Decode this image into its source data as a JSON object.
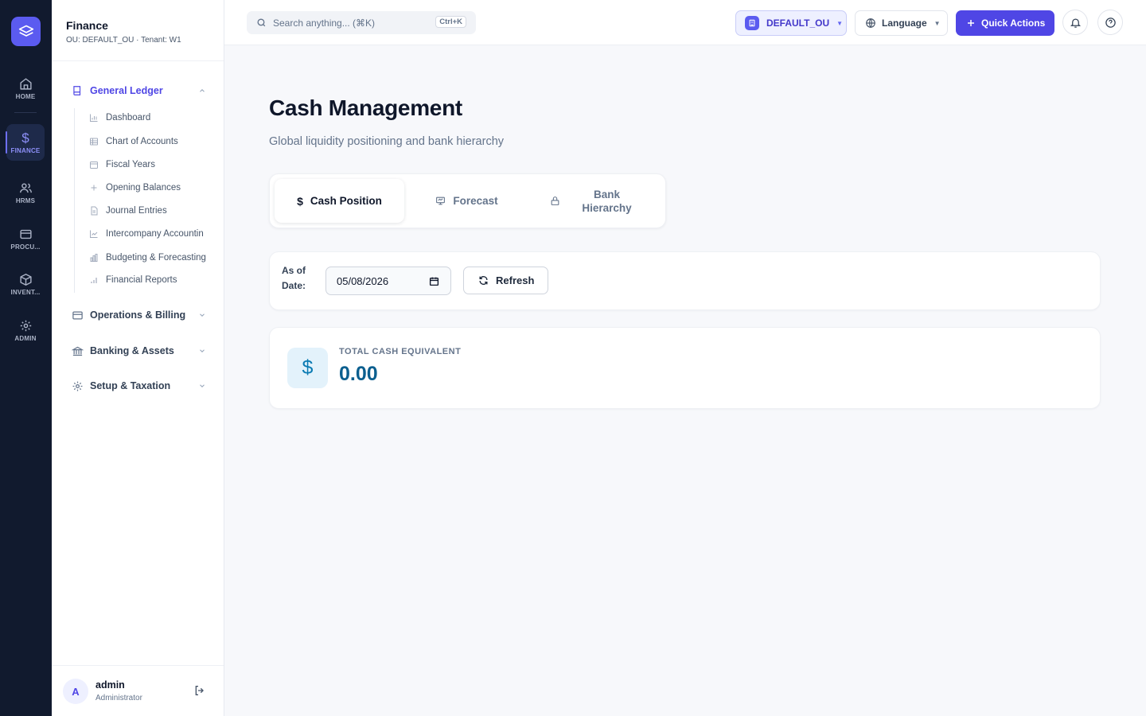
{
  "rail": {
    "items": [
      {
        "label": "HOME",
        "icon": "home-icon"
      },
      {
        "label": "FINANCE",
        "icon": "dollar-icon"
      },
      {
        "label": "HRMS",
        "icon": "users-icon"
      },
      {
        "label": "PROCU...",
        "icon": "card-icon"
      },
      {
        "label": "INVENT...",
        "icon": "box-icon"
      },
      {
        "label": "ADMIN",
        "icon": "gear-icon"
      }
    ]
  },
  "sidebar": {
    "title": "Finance",
    "subtitle": "OU: DEFAULT_OU · Tenant: W1",
    "groups": [
      {
        "label": "General Ledger",
        "icon": "book-icon"
      },
      {
        "label": "Operations & Billing",
        "icon": "card-icon"
      },
      {
        "label": "Banking & Assets",
        "icon": "bank-icon"
      },
      {
        "label": "Setup & Taxation",
        "icon": "gear-icon"
      }
    ],
    "sub_items": [
      {
        "label": "Dashboard",
        "icon": "bar-chart-icon"
      },
      {
        "label": "Chart of Accounts",
        "icon": "table-icon"
      },
      {
        "label": "Fiscal Years",
        "icon": "calendar-icon"
      },
      {
        "label": "Opening Balances",
        "icon": "plus-icon"
      },
      {
        "label": "Journal Entries",
        "icon": "document-icon"
      },
      {
        "label": "Intercompany Accountin",
        "icon": "line-chart-icon"
      },
      {
        "label": "Budgeting & Forecasting",
        "icon": "bars-icon"
      },
      {
        "label": "Financial Reports",
        "icon": "signal-icon"
      }
    ],
    "user": {
      "initial": "A",
      "name": "admin",
      "role": "Administrator"
    }
  },
  "topbar": {
    "search_placeholder": "Search anything... (⌘K)",
    "search_shortcut": "Ctrl+K",
    "ou_label": "DEFAULT_OU",
    "language_label": "Language",
    "quick_actions_label": "Quick Actions"
  },
  "main": {
    "title": "Cash Management",
    "subtitle": "Global liquidity positioning and bank hierarchy",
    "tabs": [
      {
        "label": "Cash Position",
        "icon": "dollar-icon"
      },
      {
        "label": "Forecast",
        "icon": "presentation-icon"
      },
      {
        "label": "Bank Hierarchy",
        "icon": "lock-icon"
      }
    ],
    "filter": {
      "as_of_label": "As of Date:",
      "date_value": "05/08/2026",
      "refresh_label": "Refresh"
    },
    "summary": {
      "label": "TOTAL CASH EQUIVALENT",
      "value": "0.00"
    }
  },
  "colors": {
    "accent": "#4f46e5",
    "rail_bg": "#111a2e",
    "value_blue": "#0b5f8f"
  }
}
